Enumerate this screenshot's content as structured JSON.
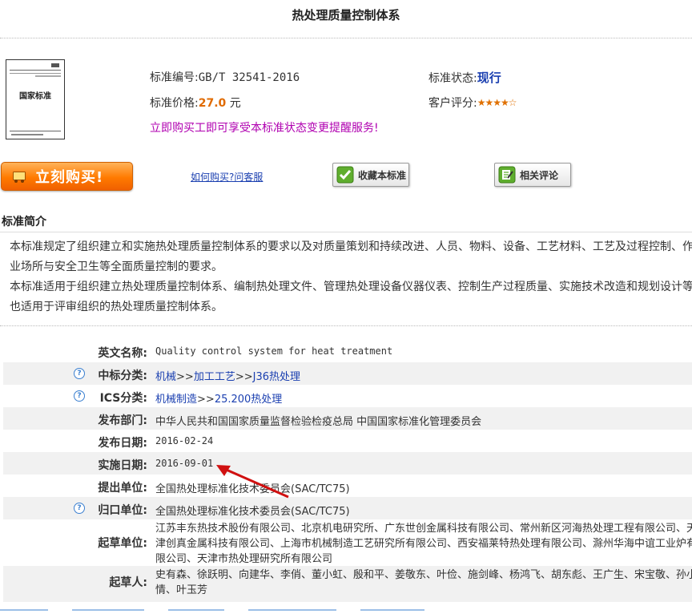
{
  "page": {
    "title": "热处理质量控制体系"
  },
  "cover": {
    "title": "国家标准",
    "header_text": "中华人民共和国国家标准"
  },
  "standard": {
    "number_label": "标准编号:",
    "number": "GB/T 32541-2016",
    "status_label": "标准状态:",
    "status": "现行",
    "price_label": "标准价格:",
    "price": "27.0",
    "price_unit": "元",
    "rating_label": "客户评分:",
    "rating": 4.5,
    "rating_stars": "★★★★☆",
    "promo": "立即购买工即可享受本标准状态变更提醒服务!"
  },
  "actions": {
    "buy_label": "立刻购买!",
    "how_to_buy": "如何购买?问客服",
    "favorite": "收藏本标准",
    "review": "相关评论"
  },
  "intro": {
    "title": "标准简介",
    "paragraphs": [
      "本标准规定了组织建立和实施热处理质量控制体系的要求以及对质量策划和持续改进、人员、物料、设备、工艺材料、工艺及过程控制、作",
      "业场所与安全卫生等全面质量控制的要求。",
      "本标准适用于组织建立热处理质量控制体系、编制热处理文件、管理热处理设备仪器仪表、控制生产过程质量、实施技术改造和规划设计等",
      "也适用于评审组织的热处理质量控制体系。"
    ]
  },
  "details": {
    "english_name_label": "英文名称:",
    "english_name": "Quality control system for heat treatment",
    "ccs_label": "中标分类:",
    "ccs": [
      "机械",
      "加工工艺",
      "J36热处理"
    ],
    "ics_label": "ICS分类:",
    "ics": [
      "机械制造",
      "25.200热处理"
    ],
    "publisher_label": "发布部门:",
    "publisher": "中华人民共和国国家质量监督检验检疫总局 中国国家标准化管理委员会",
    "publish_date_label": "发布日期:",
    "publish_date": "2016-02-24",
    "implement_date_label": "实施日期:",
    "implement_date": "2016-09-01",
    "proposer_label": "提出单位:",
    "proposer": "全国热处理标准化技术委员会(SAC/TC75)",
    "owner_label": "归口单位:",
    "owner": "全国热处理标准化技术委员会(SAC/TC75)",
    "drafters_label": "起草单位:",
    "drafters": "江苏丰东热技术股份有限公司、北京机电研究所、广东世创金属科技有限公司、常州新区河海热处理工程有限公司、天津创真金属科技有限公司、上海市机械制造工艺研究所有限公司、西安福莱特热处理有限公司、滁州华海中谊工业炉有限公司、天津市热处理研究所有限公司",
    "authors_label": "起草人:",
    "authors": "史有森、徐跃明、向建华、李俏、董小虹、殷和平、姜敬东、叶俭、施剑峰、杨鸿飞、胡东彪、王广生、宋宝敬、孙小情、叶玉芳"
  },
  "colors": {
    "accent_link": "#1a3fb0",
    "price": "#e06a00",
    "promo": "#b000b0",
    "buy_button": "#ff7a00",
    "arrow": "#d01010"
  }
}
